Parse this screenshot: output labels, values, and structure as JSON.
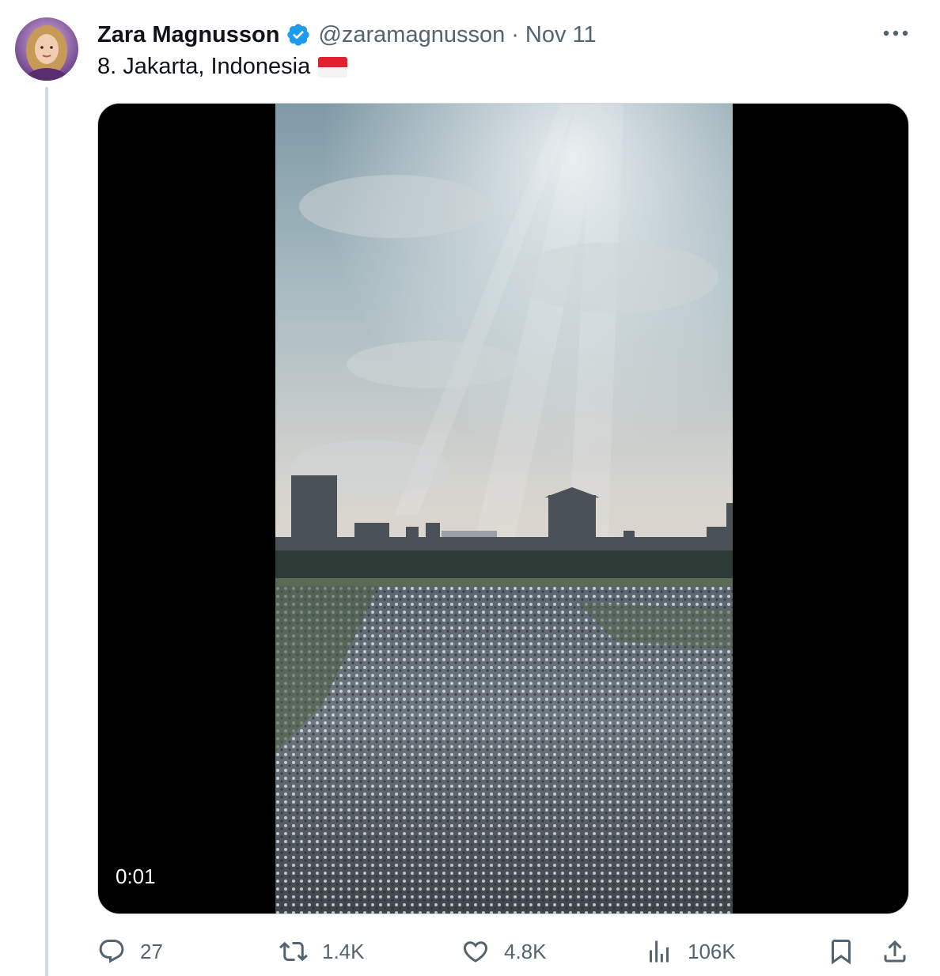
{
  "tweet": {
    "author_name": "Zara Magnusson",
    "handle": "@zaramagnusson",
    "separator": "·",
    "date": "Nov 11",
    "text": "8. Jakarta, Indonesia",
    "flag_icon": "indonesia-flag-icon"
  },
  "media": {
    "type": "video",
    "timestamp": "0:01"
  },
  "actions": {
    "replies": "27",
    "reposts": "1.4K",
    "likes": "4.8K",
    "views": "106K"
  },
  "colors": {
    "text_primary": "#0f1419",
    "text_secondary": "#536471",
    "verified_blue": "#1d9bf0",
    "thread_line": "#cfd9de"
  }
}
